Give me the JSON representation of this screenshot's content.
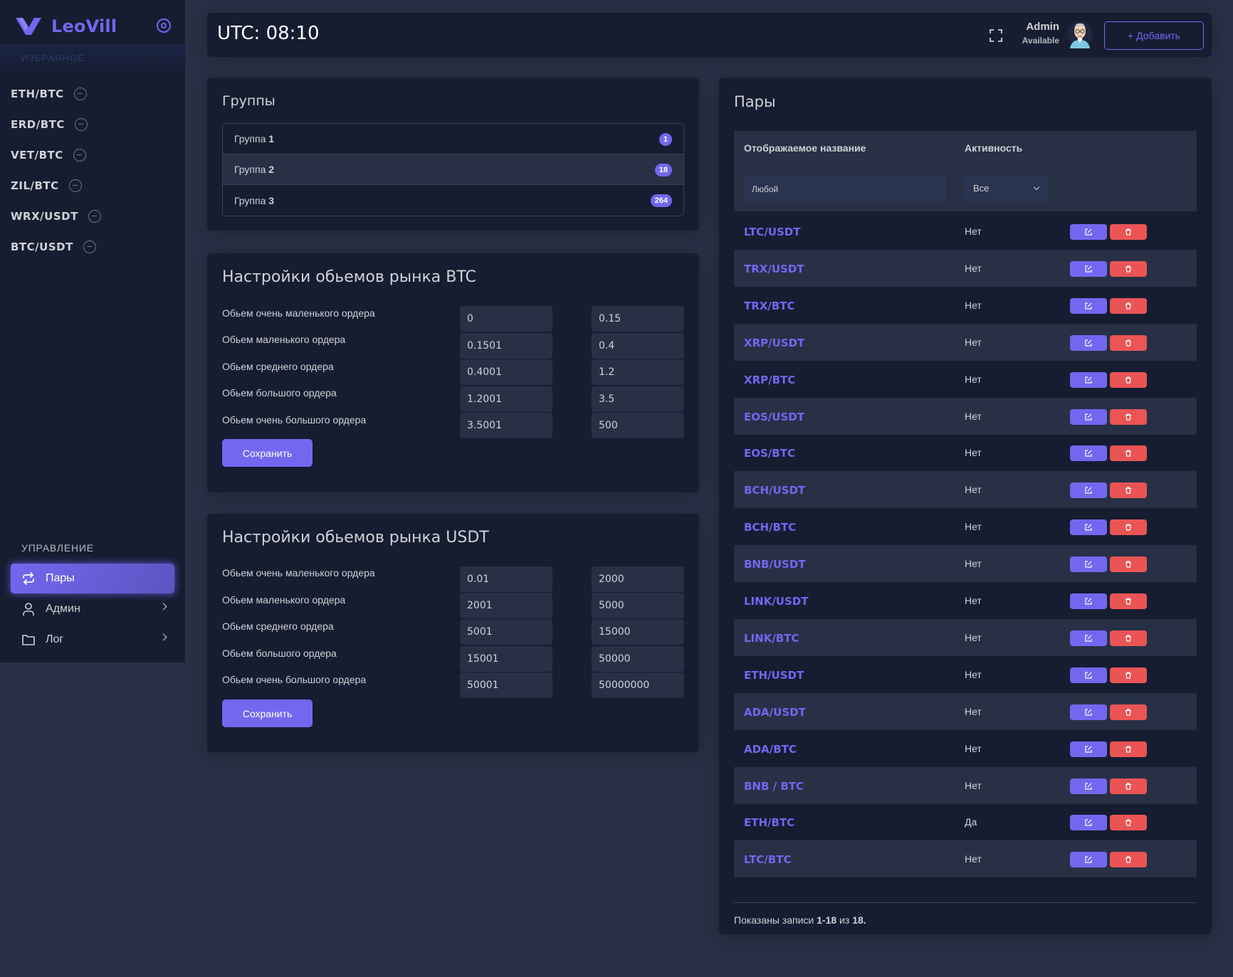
{
  "brand": {
    "name": "LeoVill"
  },
  "sidebar": {
    "favorites_header": "Избранное",
    "favorites": [
      {
        "label": "ETH/BTC"
      },
      {
        "label": "ERD/BTC"
      },
      {
        "label": "VET/BTC"
      },
      {
        "label": "ZIL/BTC"
      },
      {
        "label": "WRX/USDT"
      },
      {
        "label": "BTC/USDT"
      }
    ],
    "nav_header": "Управление",
    "nav": [
      {
        "label": "Пары",
        "icon": "repeat-icon",
        "active": true
      },
      {
        "label": "Админ",
        "icon": "user-icon"
      },
      {
        "label": "Лог",
        "icon": "folder-icon"
      }
    ]
  },
  "header": {
    "utc_label": "UTC: 08:10",
    "user_name": "Admin",
    "user_status": "Available",
    "add_button": "+ Добавить"
  },
  "groups": {
    "title": "Группы",
    "items": [
      {
        "label": "Группа ",
        "num": "1",
        "count": "1"
      },
      {
        "label": "Группа ",
        "num": "2",
        "count": "18"
      },
      {
        "label": "Группа ",
        "num": "3",
        "count": "264"
      }
    ]
  },
  "btc_volumes": {
    "title": "Настройки обьемов рынка BTC",
    "rows": [
      {
        "label": "Обьем очень маленького ордера",
        "from": "0",
        "to": "0.15"
      },
      {
        "label": "Обьем маленького ордера",
        "from": "0.1501",
        "to": "0.4"
      },
      {
        "label": "Обьем среднего ордера",
        "from": "0.4001",
        "to": "1.2"
      },
      {
        "label": "Обьем большого ордера",
        "from": "1.2001",
        "to": "3.5"
      },
      {
        "label": "Обьем очень большого ордера",
        "from": "3.5001",
        "to": "500"
      }
    ],
    "save_label": "Сохранить"
  },
  "usdt_volumes": {
    "title": "Настройки обьемов рынка USDT",
    "rows": [
      {
        "label": "Обьем очень маленького ордера",
        "from": "0.01",
        "to": "2000"
      },
      {
        "label": "Обьем маленького ордера",
        "from": "2001",
        "to": "5000"
      },
      {
        "label": "Обьем среднего ордера",
        "from": "5001",
        "to": "15000"
      },
      {
        "label": "Обьем большого ордера",
        "from": "15001",
        "to": "50000"
      },
      {
        "label": "Обьем очень большого ордера",
        "from": "50001",
        "to": "50000000"
      }
    ],
    "save_label": "Сохранить"
  },
  "pairs": {
    "title": "Пары",
    "col_name": "Отображаемое название",
    "col_activity": "Активность",
    "filter_placeholder": "Любой",
    "filter_select": "Все",
    "rows": [
      {
        "name": "LTC/USDT",
        "active": "Нет"
      },
      {
        "name": "TRX/USDT",
        "active": "Нет"
      },
      {
        "name": "TRX/BTC",
        "active": "Нет"
      },
      {
        "name": "XRP/USDT",
        "active": "Нет"
      },
      {
        "name": "XRP/BTC",
        "active": "Нет"
      },
      {
        "name": "EOS/USDT",
        "active": "Нет"
      },
      {
        "name": "EOS/BTC",
        "active": "Нет"
      },
      {
        "name": "BCH/USDT",
        "active": "Нет"
      },
      {
        "name": "BCH/BTC",
        "active": "Нет"
      },
      {
        "name": "BNB/USDT",
        "active": "Нет"
      },
      {
        "name": "LINK/USDT",
        "active": "Нет"
      },
      {
        "name": "LINK/BTC",
        "active": "Нет"
      },
      {
        "name": "ETH/USDT",
        "active": "Нет"
      },
      {
        "name": "ADA/USDT",
        "active": "Нет"
      },
      {
        "name": "ADA/BTC",
        "active": "Нет"
      },
      {
        "name": "BNB / BTC",
        "active": "Нет"
      },
      {
        "name": "ETH/BTC",
        "active": "Да"
      },
      {
        "name": "LTC/BTC",
        "active": "Нет"
      }
    ],
    "footer_prefix": "Показаны записи ",
    "footer_range": "1-18",
    "footer_mid": " из ",
    "footer_total": "18."
  }
}
